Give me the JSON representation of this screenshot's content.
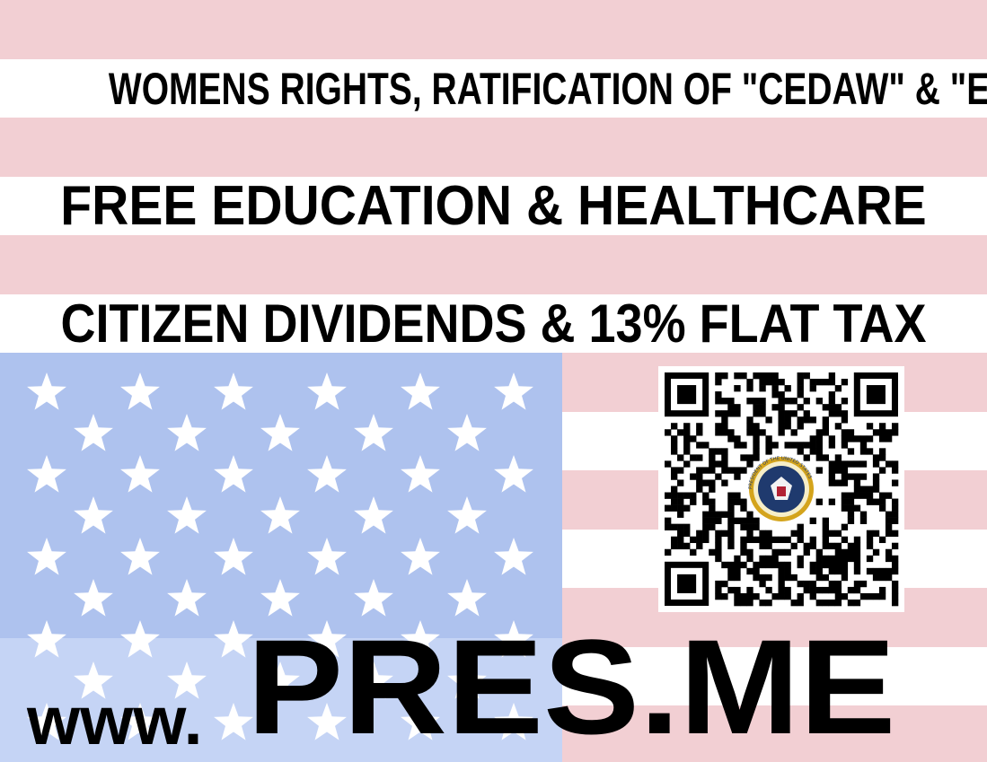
{
  "poster": {
    "line1": "WOMENS RIGHTS, RATIFICATION OF \"CEDAW\" & \"ERA\"",
    "line2": "FREE EDUCATION & HEALTHCARE",
    "line3": "CITIZEN DIVIDENDS & 13% FLAT TAX",
    "url_prefix": "www.",
    "url_domain": "PRES.ME",
    "qr_seal_text": "PRESIDENT OF THE UNITED STATES"
  },
  "colors": {
    "stripe_red": "#f2cfd3",
    "stripe_white": "#ffffff",
    "canton_blue": "#aec2ee",
    "text": "#000000",
    "seal_blue": "#1f3a6e",
    "seal_gold": "#d4a41c"
  },
  "icons": {
    "qr": "qr-code-icon",
    "seal": "presidential-seal-icon",
    "star": "star-icon"
  }
}
